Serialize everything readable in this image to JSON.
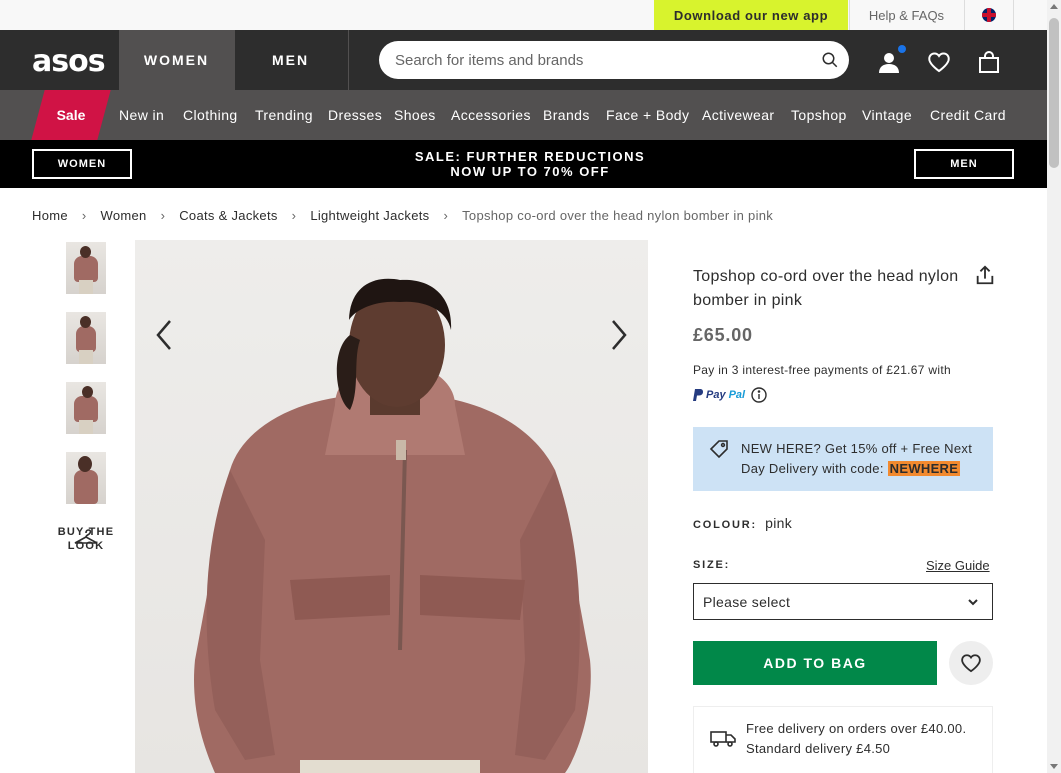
{
  "topbar": {
    "app_cta": "Download our new app",
    "help": "Help & FAQs",
    "flag_icon": "uk-flag-icon"
  },
  "header": {
    "logo": "asos",
    "tabs": [
      {
        "label": "WOMEN",
        "active": true
      },
      {
        "label": "MEN",
        "active": false
      }
    ],
    "search_placeholder": "Search for items and brands",
    "icons": [
      "account-icon",
      "heart-icon",
      "bag-icon"
    ]
  },
  "nav": {
    "items": [
      "Sale",
      "New in",
      "Clothing",
      "Trending",
      "Dresses",
      "Shoes",
      "Accessories",
      "Brands",
      "Face + Body",
      "Activewear",
      "Topshop",
      "Vintage",
      "Credit Card"
    ]
  },
  "promo": {
    "left_button": "WOMEN",
    "line1": "SALE: FURTHER REDUCTIONS",
    "line2": "NOW UP TO 70% OFF",
    "right_button": "MEN"
  },
  "breadcrumb": [
    "Home",
    "Women",
    "Coats & Jackets",
    "Lightweight Jackets",
    "Topshop co-ord over the head nylon bomber in pink"
  ],
  "gallery": {
    "buy_the_look_line1": "BUY THE",
    "buy_the_look_line2": "LOOK"
  },
  "product": {
    "title": "Topshop co-ord over the head nylon bomber in pink",
    "price": "£65.00",
    "pay_text": "Pay in 3 interest-free payments of £21.67 with",
    "paypal_pay": "Pay",
    "paypal_pal": "Pal",
    "promo_text": "NEW HERE? Get 15% off + Free Next Day Delivery with code:",
    "promo_code": "NEWHERE",
    "colour_label": "COLOUR:",
    "colour_value": "pink",
    "size_label": "SIZE:",
    "size_guide": "Size Guide",
    "size_select": "Please select",
    "add_to_bag": "ADD TO BAG",
    "delivery_line1": "Free delivery on orders over £40.00.",
    "delivery_line2": "Standard delivery £4.50"
  }
}
